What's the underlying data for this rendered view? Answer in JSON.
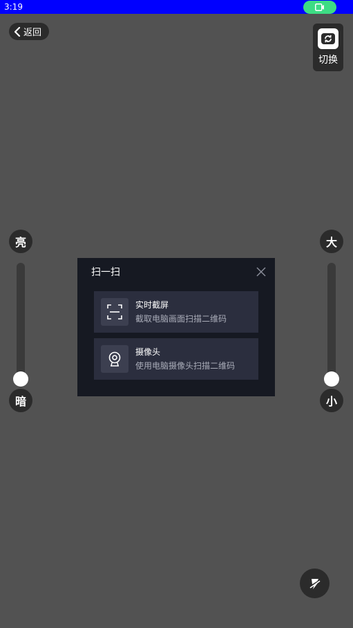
{
  "status_bar": {
    "time": "3:19",
    "pill_color": "#3ddc84",
    "bar_color": "#0000ff"
  },
  "toolbar": {
    "back_label": "返回",
    "switch_label": "切换"
  },
  "brightness": {
    "top_label": "亮",
    "bottom_label": "暗",
    "level": 0.0
  },
  "zoom": {
    "top_label": "大",
    "bottom_label": "小",
    "level": 0.0
  },
  "dialog": {
    "title": "扫一扫",
    "options": [
      {
        "icon": "scan-frame-icon",
        "title": "实时截屏",
        "description": "截取电脑画面扫描二维码"
      },
      {
        "icon": "webcam-icon",
        "title": "摄像头",
        "description": "使用电脑摄像头扫描二维码"
      }
    ]
  },
  "flashlight": {
    "icon": "flashlight-off-icon"
  }
}
